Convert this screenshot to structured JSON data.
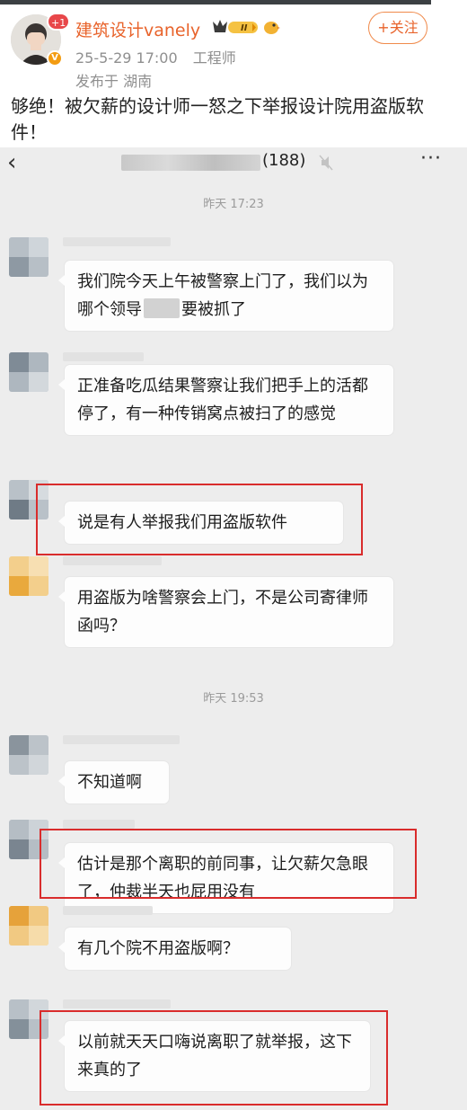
{
  "post": {
    "username": "建筑设计vanely",
    "notification_count": "+1",
    "vip_level": "II",
    "date": "25-5-29 17:00",
    "title": "工程师",
    "location": "发布于 湖南",
    "follow_label": "+关注",
    "text": "够绝！被欠薪的设计师一怒之下举报设计院用盗版软件！"
  },
  "chat": {
    "back_icon": "‹",
    "group_count": "(188)",
    "more_icon": "···",
    "timestamps": [
      "昨天 17:23",
      "昨天 19:53"
    ],
    "messages": [
      {
        "text_a": "我们院今天上午被警察上门了，我们以为哪个领导",
        "text_b": "要被抓了"
      },
      {
        "text": "正准备吃瓜结果警察让我们把手上的活都停了，有一种传销窝点被扫了的感觉"
      },
      {
        "text": "说是有人举报我们用盗版软件"
      },
      {
        "text": "用盗版为啥警察会上门，不是公司寄律师函吗？"
      },
      {
        "text": "不知道啊"
      },
      {
        "text": "估计是那个离职的前同事，让欠薪欠急眼了，仲裁半天也屁用没有"
      },
      {
        "text": "有几个院不用盗版啊？"
      },
      {
        "text": "以前就天天口嗨说离职了就举报，这下来真的了"
      }
    ]
  },
  "colors": {
    "username": "#e8632b",
    "highlight": "#d92c2c",
    "chat_background": "#ededed",
    "bubble": "#fdfdfd"
  }
}
